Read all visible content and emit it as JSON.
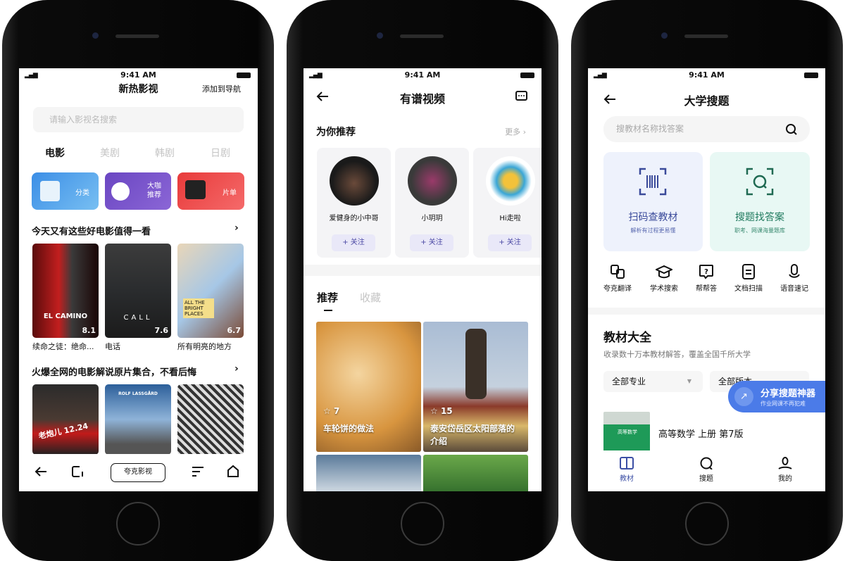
{
  "status": {
    "time": "9:41 AM",
    "signal": "▂▄▆",
    "wifi": "wifi"
  },
  "movie_app": {
    "title": "新热影视",
    "add_nav": "添加到导航",
    "search_placeholder": "请输入影视名搜索",
    "tabs": [
      "电影",
      "美剧",
      "韩剧",
      "日剧"
    ],
    "active_tab": 0,
    "categories": [
      {
        "label": "分类",
        "color": "#4a9ef0"
      },
      {
        "label": "大咖推荐",
        "color": "#7b53c9"
      },
      {
        "label": "片单",
        "color": "#ef4b4b"
      }
    ],
    "section1": {
      "title": "今天又有这些好电影值得一看",
      "arrow": "›",
      "items": [
        {
          "title": "续命之徒：绝命...",
          "rating": "8.1",
          "poster_text": "EL CAMINO"
        },
        {
          "title": "电话",
          "rating": "7.6",
          "poster_text": "CALL"
        },
        {
          "title": "所有明亮的地方",
          "rating": "6.7",
          "poster_text": "ALL THE BRIGHT PLACES"
        }
      ]
    },
    "section2": {
      "title": "火爆全网的电影解说原片集合，不看后悔",
      "arrow": "›",
      "items": [
        {
          "poster_text": "老炮儿 12.24"
        },
        {
          "poster_text": "ROLF LASSGÅRD"
        },
        {
          "poster_text": ""
        }
      ]
    },
    "bottom_button": "夸克影视"
  },
  "video_app": {
    "title": "有谱视频",
    "rec_title": "为你推荐",
    "more": "更多 ›",
    "users": [
      {
        "name": "爱健身的小中哥",
        "follow": "+ 关注"
      },
      {
        "name": "小玥玥",
        "follow": "+ 关注"
      },
      {
        "name": "Hi走啦",
        "follow": "+ 关注"
      }
    ],
    "tabs": [
      "推荐",
      "收藏"
    ],
    "active_tab": 0,
    "tiles": [
      {
        "stars": "7",
        "title": "车轮饼的做法"
      },
      {
        "stars": "15",
        "title": "泰安岱岳区太阳部落的介绍"
      }
    ],
    "accent": "#4a47a3"
  },
  "study_app": {
    "title": "大学搜题",
    "search_placeholder": "搜教材名称找答案",
    "cards": [
      {
        "title": "扫码查教材",
        "sub": "解析有过程更易懂",
        "color": "#3a4a9a"
      },
      {
        "title": "搜题找答案",
        "sub": "职考、网课海量题库",
        "color": "#1f7a5e"
      }
    ],
    "tools": [
      "夸克翻译",
      "学术搜索",
      "帮帮答",
      "文档扫描",
      "语音速记"
    ],
    "library": {
      "title": "教材大全",
      "sub": "收录数十万本教材解答，覆盖全国千所大学",
      "filters": [
        "全部专业",
        "全部版本"
      ]
    },
    "share": {
      "title": "分享搜题神器",
      "sub": "作业网课不再犯难"
    },
    "book": {
      "title": "高等数学 上册 第7版",
      "cover_text": "高等数学"
    },
    "tabbar": [
      {
        "label": "教材",
        "active": true
      },
      {
        "label": "搜题"
      },
      {
        "label": "我的"
      }
    ],
    "accent": "#3c4fa5"
  }
}
